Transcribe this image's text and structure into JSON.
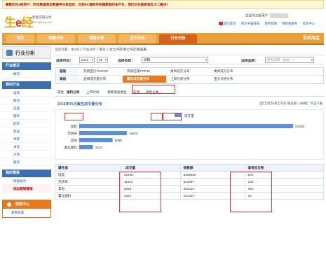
{
  "notice": "尊敬的生e经用户：昨日数据淘宝数据平台有延迟，目前PC端和手机端数据均未产生，我们正在联系淘宝小二解决！",
  "logo": {
    "main_a": "生",
    "main_b": "e",
    "main_c": "经",
    "sub1": "智能店铺分析",
    "sub2": "shengejing.com"
  },
  "user": {
    "greeting": "您是专注版用户"
  },
  "toplinks": [
    "提交意见",
    "购买天猫旺旺",
    "使用指南",
    "授权版服务",
    "帮助中心"
  ],
  "nav": {
    "tabs": [
      "首页",
      "流量分析",
      "销售分析",
      "宝贝分析",
      "行业分析"
    ],
    "active": 4,
    "right": "手机淘宝"
  },
  "sidebar": {
    "title": "行业分析",
    "sections": [
      {
        "title": "行业概况",
        "items": [
          "概况"
        ]
      },
      {
        "title": "我的行业",
        "items": [
          "虚拟",
          "数码",
          "美容",
          "服装",
          "配饰",
          "家居",
          "母婴",
          "食品",
          "文体",
          "服务"
        ]
      },
      {
        "title": "我的情报",
        "items": [
          "情报助手",
          "添加营销情报"
        ]
      }
    ],
    "current": "添加营销情报",
    "help_title": "帮助中心",
    "help_items": [
      "使用指南"
    ]
  },
  "breadcrumb": [
    "当前位置：生e经",
    "行业分析",
    "服装",
    "女士内衣/男士内衣/家居服"
  ],
  "filter": {
    "time_label": "选择时间：",
    "year": "2016",
    "month": "05",
    "category_label": "选择类目：",
    "category": "抹胸",
    "brand_label": "选择品牌：",
    "brand_placeholder": "所有品牌（搜索...）"
  },
  "grid": {
    "rows": [
      {
        "head": "基础",
        "options": [
          "热销宝贝TOP100",
          "热销店铺TOP30",
          "类目成交分布",
          "类目成交分布"
        ]
      },
      {
        "head": "高级",
        "options": [
          "品牌成交量分布",
          "属性成交量分布",
          "上架时间分布",
          "宝贝价格分布"
        ]
      }
    ],
    "active": [
      1,
      1
    ]
  },
  "subtabs": [
    "属性",
    "面料分类",
    "上市时间",
    "销售渠道类型",
    "形状",
    "颜色分类"
  ],
  "subtab_active": 1,
  "chart_heading": "2016年05月属性成交量分布",
  "chart_path": "【女士内衣/男士内衣/家居服 > 抹胸】",
  "chart_link": "点击下载",
  "chart_data": {
    "type": "bar",
    "orientation": "horizontal",
    "categories": [
      "硅胶",
      "无纺布",
      "其他",
      "蕾丝面料"
    ],
    "series": [
      {
        "name": "成交量",
        "values": [
          51848,
          11543,
          8089,
          3324
        ]
      }
    ],
    "xlim": [
      0,
      52000
    ],
    "bar_color": "#5b8fd6"
  },
  "table": {
    "headers": [
      "属性值",
      "↓成交量",
      "销售额",
      "高销宝贝数"
    ],
    "rows": [
      [
        "硅胶",
        "51848",
        "3206839",
        "500"
      ],
      [
        "无纺布",
        "11543",
        "624497",
        "130"
      ],
      [
        "其他",
        "8089",
        "391210",
        "150"
      ],
      [
        "蕾丝面料",
        "3324",
        "107327",
        "18"
      ]
    ]
  }
}
